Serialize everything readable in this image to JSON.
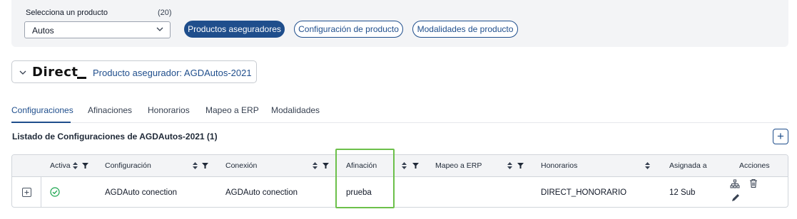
{
  "colors": {
    "primary": "#1f4e8c",
    "success": "#16a34a",
    "highlight": "#6cc04a"
  },
  "product_selector": {
    "label": "Selecciona un producto",
    "count": "(20)",
    "value": "Autos"
  },
  "nav_buttons": [
    {
      "label": "Productos aseguradores",
      "active": true
    },
    {
      "label": "Configuración de producto",
      "active": false
    },
    {
      "label": "Modalidades de producto",
      "active": false
    }
  ],
  "product_card": {
    "logo_text": "Direct",
    "title": "Producto asegurador: AGDAutos-2021"
  },
  "tabs": [
    {
      "label": "Configuraciones",
      "active": true
    },
    {
      "label": "Afinaciones"
    },
    {
      "label": "Honorarios"
    },
    {
      "label": "Mapeo a ERP"
    },
    {
      "label": "Modalidades"
    }
  ],
  "list": {
    "title": "Listado de Configuraciones de AGDAutos-2021 (1)",
    "add_label": "+",
    "columns": [
      "Activa",
      "Configuración",
      "Conexión",
      "Afinación",
      "Mapeo a ERP",
      "Honorarios",
      "Asignada a",
      "Acciones"
    ],
    "rows": [
      {
        "activa": true,
        "configuracion": "AGDAuto conection",
        "conexion": "AGDAuto conection",
        "afinacion": "prueba",
        "mapeo_erp": "",
        "honorarios": "DIRECT_HONORARIO",
        "asignada_a": "12 Sub",
        "actions": [
          "hierarchy-icon",
          "trash-icon",
          "pencil-icon"
        ]
      }
    ]
  }
}
